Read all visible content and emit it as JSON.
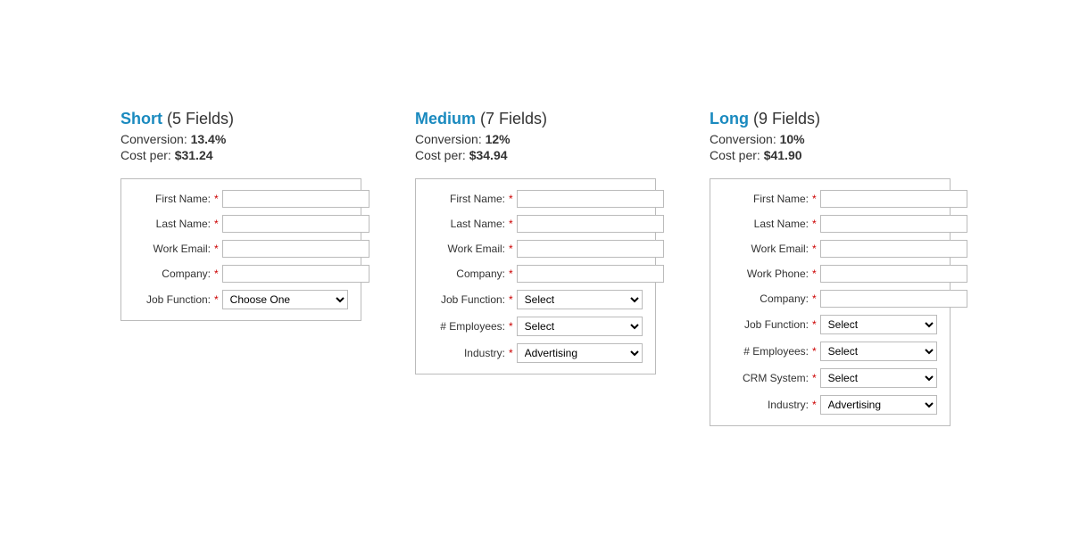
{
  "forms": [
    {
      "id": "short",
      "title_plain": "Short ",
      "title_highlight": "(5 Fields)",
      "conversion_label": "Conversion: ",
      "conversion_value": "13.4%",
      "cost_label": "Cost per: ",
      "cost_value": "$31.24",
      "fields": [
        {
          "label": "First Name:",
          "type": "input",
          "required": true
        },
        {
          "label": "Last Name:",
          "type": "input",
          "required": true
        },
        {
          "label": "Work Email:",
          "type": "input",
          "required": true
        },
        {
          "label": "Company:",
          "type": "input",
          "required": true
        },
        {
          "label": "Job Function:",
          "type": "select",
          "required": true,
          "placeholder": "Choose One"
        }
      ]
    },
    {
      "id": "medium",
      "title_plain": "Medium ",
      "title_highlight": "(7 Fields)",
      "conversion_label": "Conversion: ",
      "conversion_value": "12%",
      "cost_label": "Cost per: ",
      "cost_value": "$34.94",
      "fields": [
        {
          "label": "First Name:",
          "type": "input",
          "required": true
        },
        {
          "label": "Last Name:",
          "type": "input",
          "required": true
        },
        {
          "label": "Work Email:",
          "type": "input",
          "required": true
        },
        {
          "label": "Company:",
          "type": "input",
          "required": true
        },
        {
          "label": "Job Function:",
          "type": "select",
          "required": true,
          "placeholder": "Select"
        },
        {
          "label": "# Employees:",
          "type": "select",
          "required": true,
          "placeholder": "Select"
        },
        {
          "label": "Industry:",
          "type": "select",
          "required": true,
          "placeholder": "Advertising"
        }
      ]
    },
    {
      "id": "long",
      "title_plain": "Long ",
      "title_highlight": "(9 Fields)",
      "conversion_label": "Conversion: ",
      "conversion_value": "10%",
      "cost_label": "Cost per: ",
      "cost_value": "$41.90",
      "fields": [
        {
          "label": "First Name:",
          "type": "input",
          "required": true
        },
        {
          "label": "Last Name:",
          "type": "input",
          "required": true
        },
        {
          "label": "Work Email:",
          "type": "input",
          "required": true
        },
        {
          "label": "Work Phone:",
          "type": "input",
          "required": true
        },
        {
          "label": "Company:",
          "type": "input",
          "required": true
        },
        {
          "label": "Job Function:",
          "type": "select",
          "required": true,
          "placeholder": "Select"
        },
        {
          "label": "# Employees:",
          "type": "select",
          "required": true,
          "placeholder": "Select"
        },
        {
          "label": "CRM System:",
          "type": "select",
          "required": true,
          "placeholder": "Select"
        },
        {
          "label": "Industry:",
          "type": "select",
          "required": true,
          "placeholder": "Advertising"
        }
      ]
    }
  ]
}
